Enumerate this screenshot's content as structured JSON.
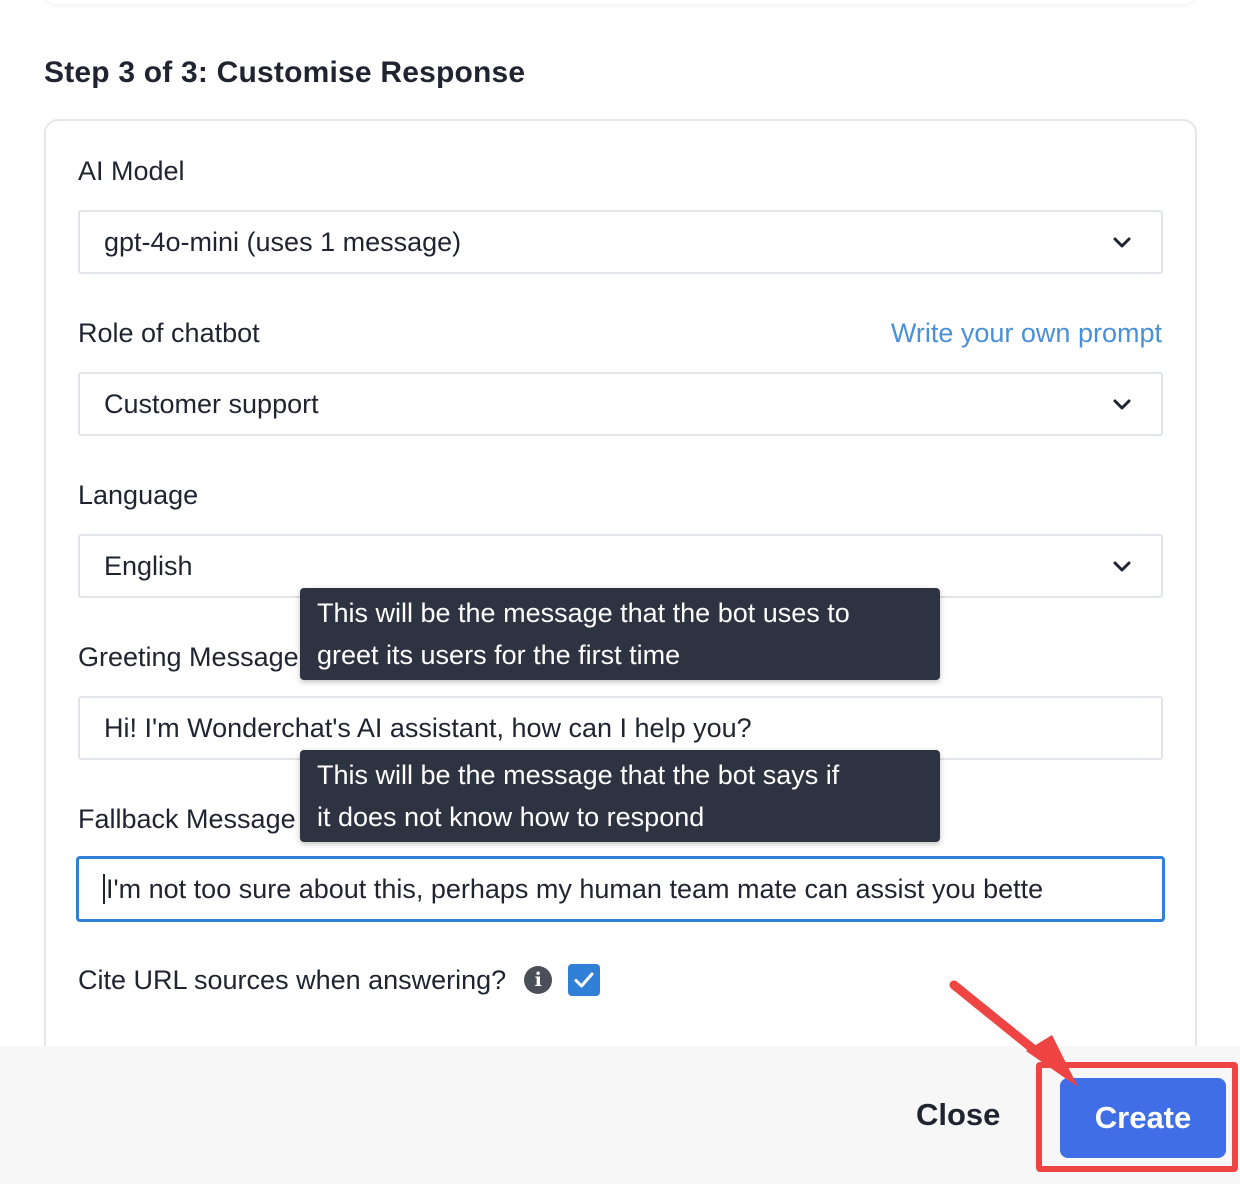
{
  "step_title": "Step 3 of 3: Customise Response",
  "fields": {
    "ai_model": {
      "label": "AI Model",
      "value": "gpt-4o-mini (uses 1 message)"
    },
    "role": {
      "label": "Role of chatbot",
      "value": "Customer support",
      "link": "Write your own prompt"
    },
    "language": {
      "label": "Language",
      "value": "English"
    },
    "greeting": {
      "label": "Greeting Message",
      "value": "Hi! I'm Wonderchat's AI assistant, how can I help you?",
      "tooltip_line1": "This will be the message that the bot uses to",
      "tooltip_line2": "greet its users for the first time"
    },
    "fallback": {
      "label": "Fallback Message",
      "value": "I'm not too sure about this, perhaps my human team mate can assist you bette",
      "tooltip_line1": "This will be the message that the bot says if",
      "tooltip_line2": "it does not know how to respond"
    },
    "cite": {
      "label": "Cite URL sources when answering?",
      "checked": true
    }
  },
  "footer": {
    "close_label": "Close",
    "create_label": "Create"
  },
  "colors": {
    "accent": "#2f80d6",
    "create": "#3f6ee6",
    "annotation": "#ee4444",
    "tooltip_bg": "#2d3340"
  },
  "icons": [
    "chevron-down-icon",
    "info-icon",
    "checkmark-icon",
    "arrow-annotation"
  ]
}
